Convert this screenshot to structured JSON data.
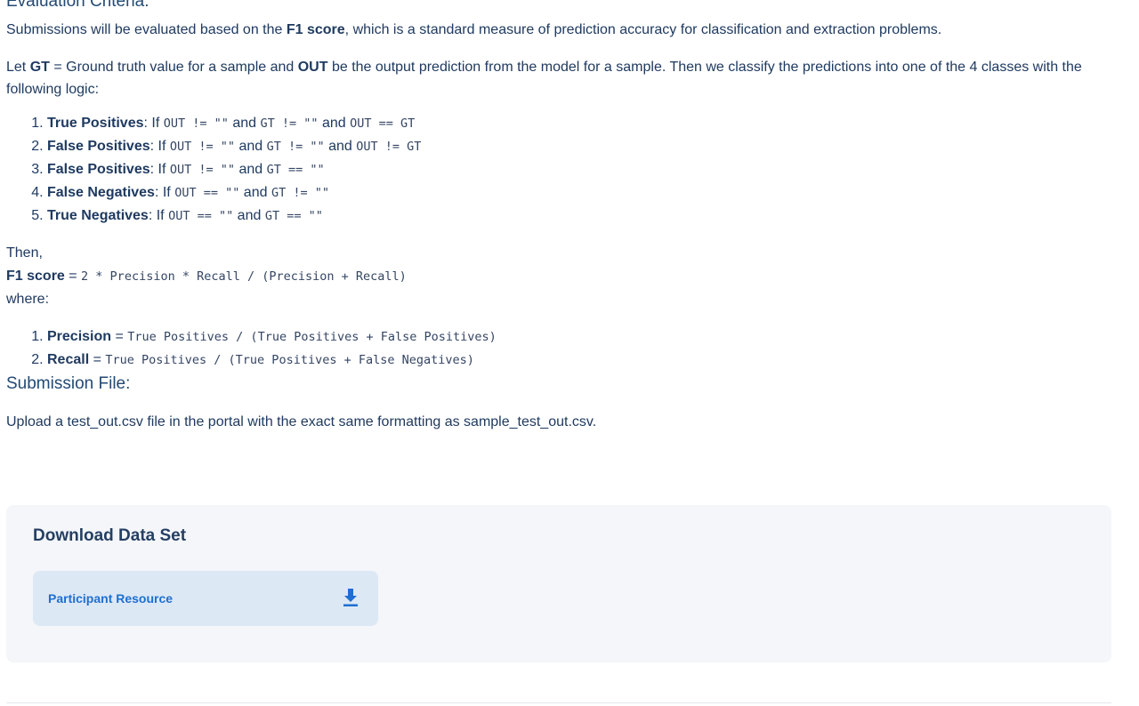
{
  "evaluation": {
    "title": "Evaluation Criteria:",
    "intro_before": "Submissions will be evaluated based on the ",
    "intro_bold": "F1 score",
    "intro_after": ", which is a standard measure of prediction accuracy for classification and extraction problems.",
    "def_1": "Let ",
    "def_gt": "GT",
    "def_2": " = Ground truth value for a sample and ",
    "def_out": "OUT",
    "def_3": " be the output prediction from the model for a sample. Then we classify the predictions into one of the 4 classes with the following logic:",
    "rules": [
      {
        "name": "True Positives",
        "if": ": If ",
        "c1": "OUT != \"\"",
        "and1": " and ",
        "c2": "GT != \"\"",
        "and2": " and ",
        "c3": "OUT == GT"
      },
      {
        "name": "False Positives",
        "if": ": If ",
        "c1": "OUT != \"\"",
        "and1": " and ",
        "c2": "GT != \"\"",
        "and2": " and ",
        "c3": "OUT != GT"
      },
      {
        "name": "False Positives",
        "if": ": If ",
        "c1": "OUT != \"\"",
        "and1": " and ",
        "c2": "GT == \"\""
      },
      {
        "name": "False Negatives",
        "if": ": If ",
        "c1": "OUT == \"\"",
        "and1": " and ",
        "c2": "GT != \"\""
      },
      {
        "name": "True Negatives",
        "if": ": If ",
        "c1": "OUT == \"\"",
        "and1": " and ",
        "c2": "GT == \"\""
      }
    ],
    "then": "Then,",
    "f1_label": "F1 score",
    "f1_eq": " = ",
    "f1_formula": "2 * Precision * Recall / (Precision + Recall)",
    "where": "where:",
    "metrics": [
      {
        "name": "Precision",
        "eq": " = ",
        "formula": "True Positives / (True Positives + False Positives)"
      },
      {
        "name": "Recall",
        "eq": " = ",
        "formula": "True Positives / (True Positives + False Negatives)"
      }
    ]
  },
  "submission": {
    "title": "Submission File:",
    "text": "Upload a test_out.csv file in the portal with the exact same formatting as sample_test_out.csv."
  },
  "download": {
    "title": "Download Data Set",
    "resource_label": "Participant Resource",
    "icon": "download-icon",
    "accent": "#1f6fd0"
  }
}
